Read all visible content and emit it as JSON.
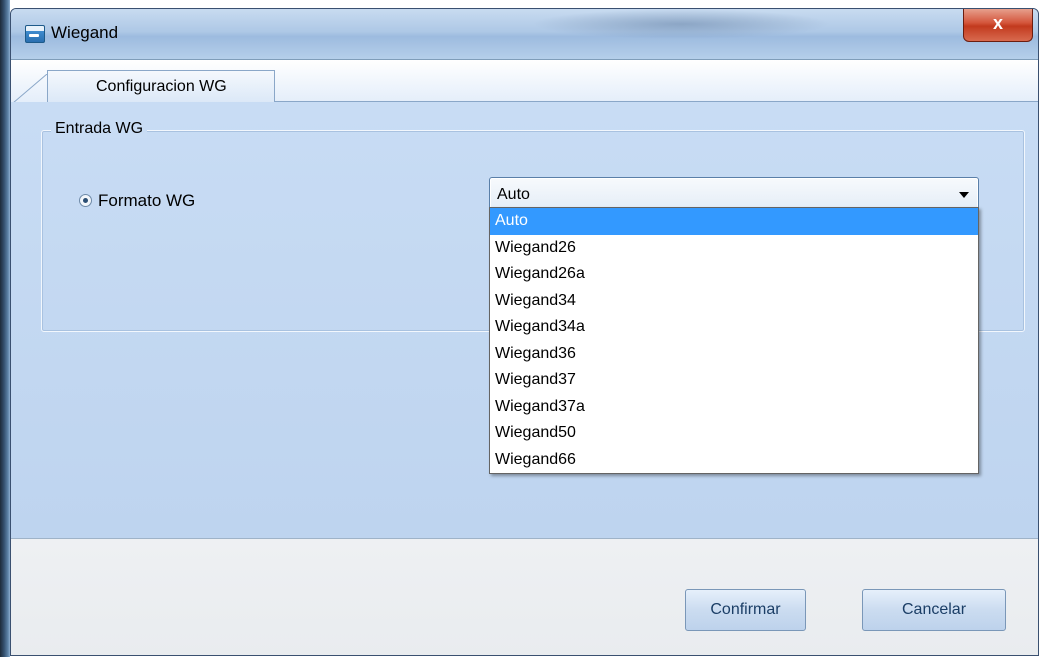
{
  "window": {
    "title": "Wiegand",
    "close_label": "x"
  },
  "tabs": [
    {
      "label": "Configuracion WG",
      "active": true
    }
  ],
  "group": {
    "legend": "Entrada WG"
  },
  "format": {
    "radio_label": "Formato WG",
    "radio_checked": true,
    "selected_value": "Auto",
    "options": [
      "Auto",
      "Wiegand26",
      "Wiegand26a",
      "Wiegand34",
      "Wiegand34a",
      "Wiegand36",
      "Wiegand37",
      "Wiegand37a",
      "Wiegand50",
      "Wiegand66"
    ],
    "highlighted_option": "Auto"
  },
  "buttons": {
    "confirm_label": "Confirmar",
    "cancel_label": "Cancelar"
  },
  "colors": {
    "selection_highlight": "#3399ff",
    "close_button": "#c23a1e",
    "content_background": "#c8dcf4"
  }
}
